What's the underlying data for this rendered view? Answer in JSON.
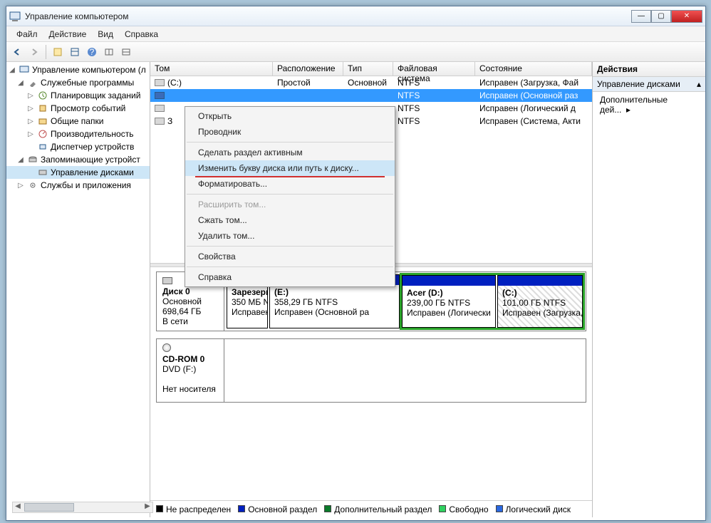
{
  "title": "Управление компьютером",
  "menus": [
    "Файл",
    "Действие",
    "Вид",
    "Справка"
  ],
  "tree": {
    "root": "Управление компьютером (л",
    "services_group": "Служебные программы",
    "task_scheduler": "Планировщик заданий",
    "event_viewer": "Просмотр событий",
    "shared_folders": "Общие папки",
    "performance": "Производительность",
    "device_manager": "Диспетчер устройств",
    "storage_group": "Запоминающие устройст",
    "disk_mgmt": "Управление дисками",
    "services_apps": "Службы и приложения"
  },
  "vol_headers": {
    "volume": "Том",
    "layout": "Расположение",
    "type": "Тип",
    "fs": "Файловая система",
    "status": "Состояние"
  },
  "volumes": [
    {
      "name": "(C:)",
      "layout": "Простой",
      "type": "Основной",
      "fs": "NTFS",
      "status": "Исправен (Загрузка, Фай"
    },
    {
      "name": "",
      "layout": "",
      "type": "",
      "fs": "NTFS",
      "status": "Исправен (Основной раз"
    },
    {
      "name": "",
      "layout": "",
      "type": "",
      "fs": "NTFS",
      "status": "Исправен (Логический д"
    },
    {
      "name": "З",
      "layout": "",
      "type": "",
      "fs": "NTFS",
      "status": "Исправен (Система, Акти"
    }
  ],
  "ctx": {
    "open": "Открыть",
    "explorer": "Проводник",
    "mark_active": "Сделать раздел активным",
    "change_letter": "Изменить букву диска или путь к диску...",
    "format": "Форматировать...",
    "extend": "Расширить том...",
    "shrink": "Сжать том...",
    "delete": "Удалить том...",
    "props": "Свойства",
    "help": "Справка"
  },
  "disk0": {
    "title": "Диск 0",
    "type": "Основной",
    "size": "698,64 ГБ",
    "state": "В сети",
    "p1": {
      "name": "Зарезерв",
      "size": "350 МБ N",
      "status": "Исправен"
    },
    "p2": {
      "name": "(E:)",
      "size": "358,29 ГБ NTFS",
      "status": "Исправен (Основной ра"
    },
    "p3": {
      "name": "Acer (D:)",
      "size": "239,00 ГБ NTFS",
      "status": "Исправен (Логически"
    },
    "p4": {
      "name": "(C:)",
      "size": "101,00 ГБ NTFS",
      "status": "Исправен (Загрузка,"
    }
  },
  "cdrom": {
    "title": "CD-ROM 0",
    "sub": "DVD (F:)",
    "state": "Нет носителя"
  },
  "legend": {
    "unalloc": "Не распределен",
    "primary": "Основной раздел",
    "extended": "Дополнительный раздел",
    "free": "Свободно",
    "logical": "Логический диск"
  },
  "actions": {
    "header": "Действия",
    "sub": "Управление дисками",
    "more": "Дополнительные дей..."
  }
}
